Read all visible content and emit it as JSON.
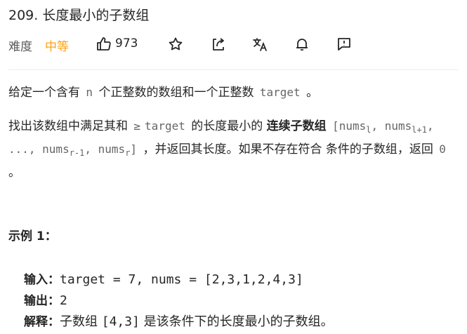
{
  "problem": {
    "title": "209. 长度最小的子数组"
  },
  "meta": {
    "difficulty_label": "难度",
    "difficulty_value": "中等",
    "likes": "973",
    "icons": [
      "thumbs-up-icon",
      "star-icon",
      "share-icon",
      "translate-icon",
      "bell-icon",
      "feedback-icon"
    ]
  },
  "description": {
    "p1_a": "给定一个含有",
    "p1_n": "n",
    "p1_b": "个正整数的数组和一个正整数",
    "p1_target": "target",
    "p1_end": "。",
    "p2_a": "找出该数组中满足其和",
    "p2_ge": "≥",
    "p2_target": "target",
    "p2_b": "的长度最小的",
    "p2_bold": "连续子数组",
    "p2_arr_1": "[nums",
    "p2_sub_l": "l",
    "p2_arr_2": ",",
    "p2_arr_3": "nums",
    "p2_sub_l1": "l+1",
    "p2_arr_4": ", ..., nums",
    "p2_sub_r1": "r-1",
    "p2_arr_5": ", nums",
    "p2_sub_r": "r",
    "p2_arr_6": "]",
    "p2_c": "，并返回其长度。如果不存在符合",
    "p2_d": "条件的子数组，返回",
    "p2_zero": "0",
    "p2_end": "。"
  },
  "example": {
    "title": "示例 1：",
    "input_label": "输入：",
    "input_value": "target = 7, nums = [2,3,1,2,4,3]",
    "output_label": "输出：",
    "output_value": "2",
    "explain_label": "解释：",
    "explain_a": "子数组",
    "explain_code": "[4,3]",
    "explain_b": "是该条件下的长度最小的子数组。"
  }
}
